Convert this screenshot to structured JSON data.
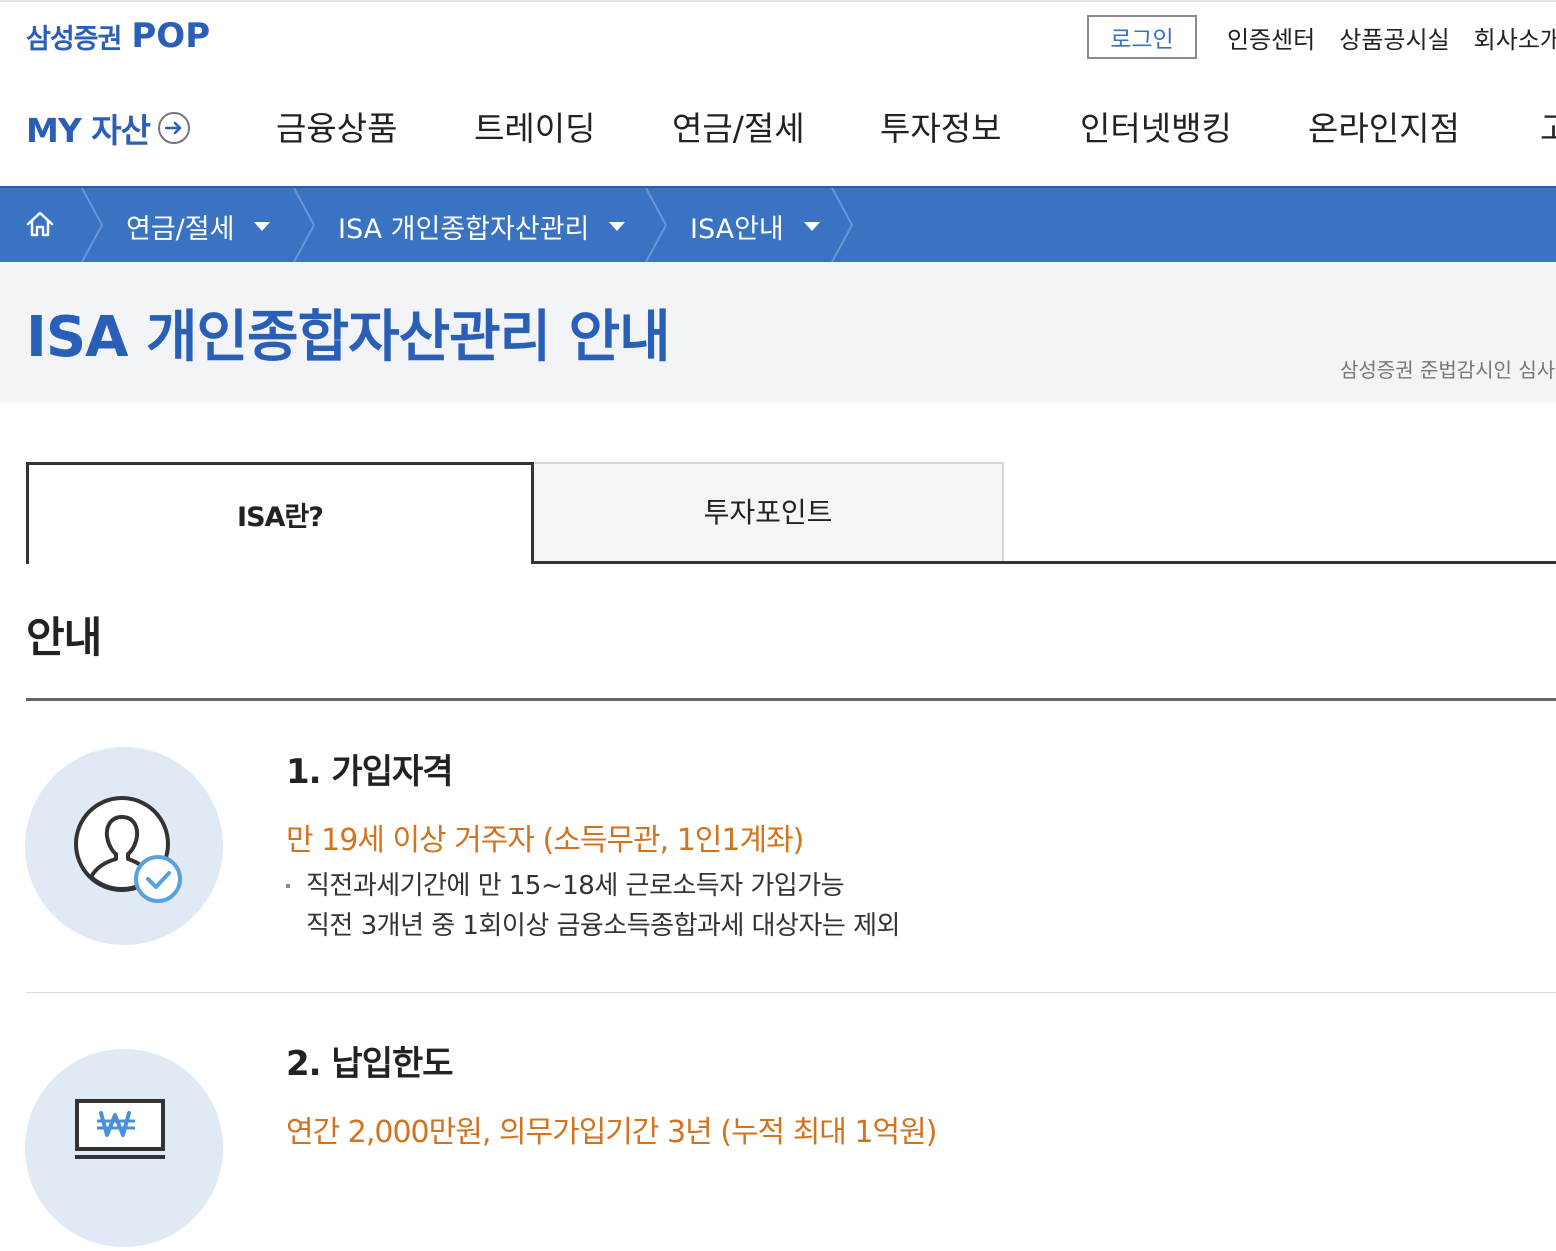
{
  "header": {
    "logo_text": "삼성증권",
    "logo_pop": "POP",
    "login_label": "로그인",
    "util_links": [
      "인증센터",
      "상품공시실",
      "회사소개"
    ]
  },
  "nav": {
    "my_asset": "MY 자산",
    "items": [
      "금융상품",
      "트레이딩",
      "연금/절세",
      "투자정보",
      "인터넷뱅킹",
      "온라인지점",
      "고객센터"
    ]
  },
  "breadcrumb": {
    "items": [
      "연금/절세",
      "ISA 개인종합자산관리",
      "ISA안내"
    ]
  },
  "page": {
    "title": "ISA 개인종합자산관리 안내",
    "note": "삼성증권 준법감시인 심사필"
  },
  "tabs": {
    "active": "ISA란?",
    "inactive": "투자포인트"
  },
  "section": {
    "title": "안내"
  },
  "items": [
    {
      "title": "1. 가입자격",
      "highlight": "만 19세 이상 거주자 (소득무관, 1인1계좌)",
      "bullet_line1": "직전과세기간에 만 15~18세 근로소득자 가입가능",
      "bullet_line2": "직전 3개년 중 1회이상 금융소득종합과세 대상자는 제외",
      "icon": "user-check-icon"
    },
    {
      "title": "2. 납입한도",
      "highlight": "연간 2,000만원, 의무가입기간 3년 (누적 최대 1억원)",
      "icon": "won-register-icon"
    }
  ],
  "colors": {
    "brand": "#2a5fb8",
    "breadcrumb_bg": "#3a73c2",
    "highlight": "#d2731f",
    "icon_circle": "#dfeaf5"
  }
}
